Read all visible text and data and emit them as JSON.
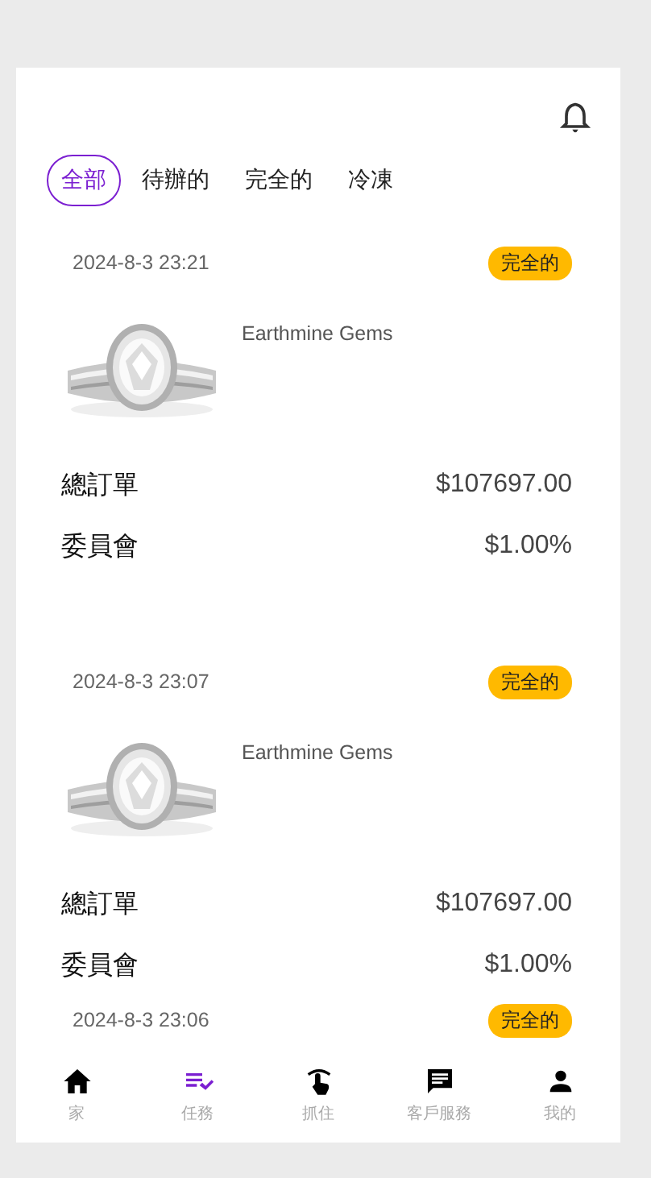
{
  "tabs": [
    {
      "label": "全部",
      "selected": true
    },
    {
      "label": "待辦的",
      "selected": false
    },
    {
      "label": "完全的",
      "selected": false
    },
    {
      "label": "冷凍",
      "selected": false
    }
  ],
  "orders": [
    {
      "date": "2024-8-3 23:21",
      "status": "完全的",
      "product": {
        "kind": "picture",
        "name": "Earthmine Gems"
      },
      "rows": [
        {
          "label": "總訂單",
          "value": "$107697.00"
        },
        {
          "label": "委員會",
          "value": "$1.00%"
        }
      ]
    },
    {
      "date": "2024-8-3 23:07",
      "status": "完全的",
      "product": {
        "kind": "picture",
        "name": "Earthmine Gems"
      },
      "rows": [
        {
          "label": "總訂單",
          "value": "$107697.00"
        },
        {
          "label": "委員會",
          "value": "$1.00%"
        }
      ]
    },
    {
      "date": "2024-8-3 23:06",
      "status": "完全的"
    }
  ],
  "nav": [
    {
      "kind": "home",
      "label": "家",
      "selected": false
    },
    {
      "kind": "tasks",
      "label": "任務",
      "selected": true
    },
    {
      "kind": "grab",
      "label": "抓住",
      "selected": false
    },
    {
      "kind": "chat",
      "label": "客戶服務",
      "selected": false
    },
    {
      "kind": "person",
      "label": "我的",
      "selected": false
    }
  ]
}
